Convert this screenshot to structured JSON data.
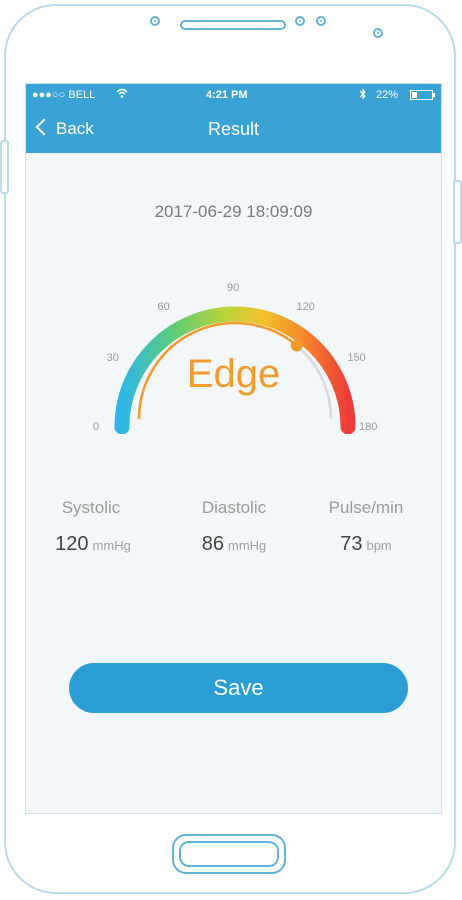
{
  "status_bar": {
    "carrier": "●●●○○ BELL",
    "wifi_icon": "wifi-icon",
    "time": "4:21 PM",
    "bluetooth_icon": "bluetooth-icon",
    "battery": "22%"
  },
  "nav": {
    "back_label": "Back",
    "title": "Result"
  },
  "measurement": {
    "timestamp": "2017-06-29 18:09:09",
    "status": "Edge",
    "gauge_ticks": [
      "0",
      "30",
      "60",
      "90",
      "120",
      "150",
      "180"
    ],
    "gauge_value": 130,
    "gauge_max": 180
  },
  "metrics": [
    {
      "label": "Systolic",
      "value": "120",
      "unit": "mmHg"
    },
    {
      "label": "Diastolic",
      "value": "86",
      "unit": "mmHg"
    },
    {
      "label": "Pulse/min",
      "value": "73",
      "unit": "bpm"
    }
  ],
  "save_label": "Save",
  "colors": {
    "accent": "#3aa3d6",
    "status": "#f29b2a",
    "button": "#2c9ed6"
  }
}
